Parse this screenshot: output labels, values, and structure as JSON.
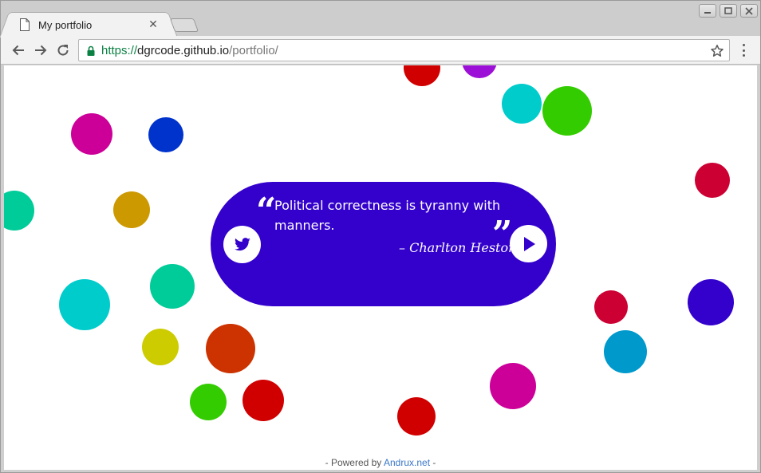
{
  "tab": {
    "title": "My portfolio",
    "close_glyph": "✕"
  },
  "toolbar": {
    "url_scheme": "https://",
    "url_host": "dgrcode.github.io",
    "url_path": "/portfolio/"
  },
  "quote": {
    "open_glyph": "“",
    "close_glyph": "”",
    "text": "Political correctness is tyranny with manners.",
    "author": "– Charlton Heston"
  },
  "footer": {
    "prefix": "- Powered by ",
    "link_text": "Andrux.net",
    "suffix": " -"
  },
  "icons": {
    "tab_page": "page-icon",
    "back": "arrow-left-icon",
    "forward": "arrow-right-icon",
    "reload": "reload-icon",
    "lock": "lock-icon",
    "star": "star-icon",
    "menu": "kebab-menu-icon",
    "twitter": "twitter-icon",
    "next": "play-icon"
  },
  "colors": {
    "card": "#3300cc",
    "secure": "#0b8043",
    "link": "#3a77c8",
    "bubbles": [
      "#d10000",
      "#9b0fd6",
      "#00cccc",
      "#33cc00",
      "#cc0099",
      "#0033cc",
      "#cc0033",
      "#00cc99",
      "#cc9900",
      "#00cccc",
      "#00cc99",
      "#cccc00",
      "#cc3300",
      "#33cc00",
      "#d10000",
      "#cc0099",
      "#d10000",
      "#0099cc",
      "#cc0033",
      "#3300cc"
    ]
  }
}
